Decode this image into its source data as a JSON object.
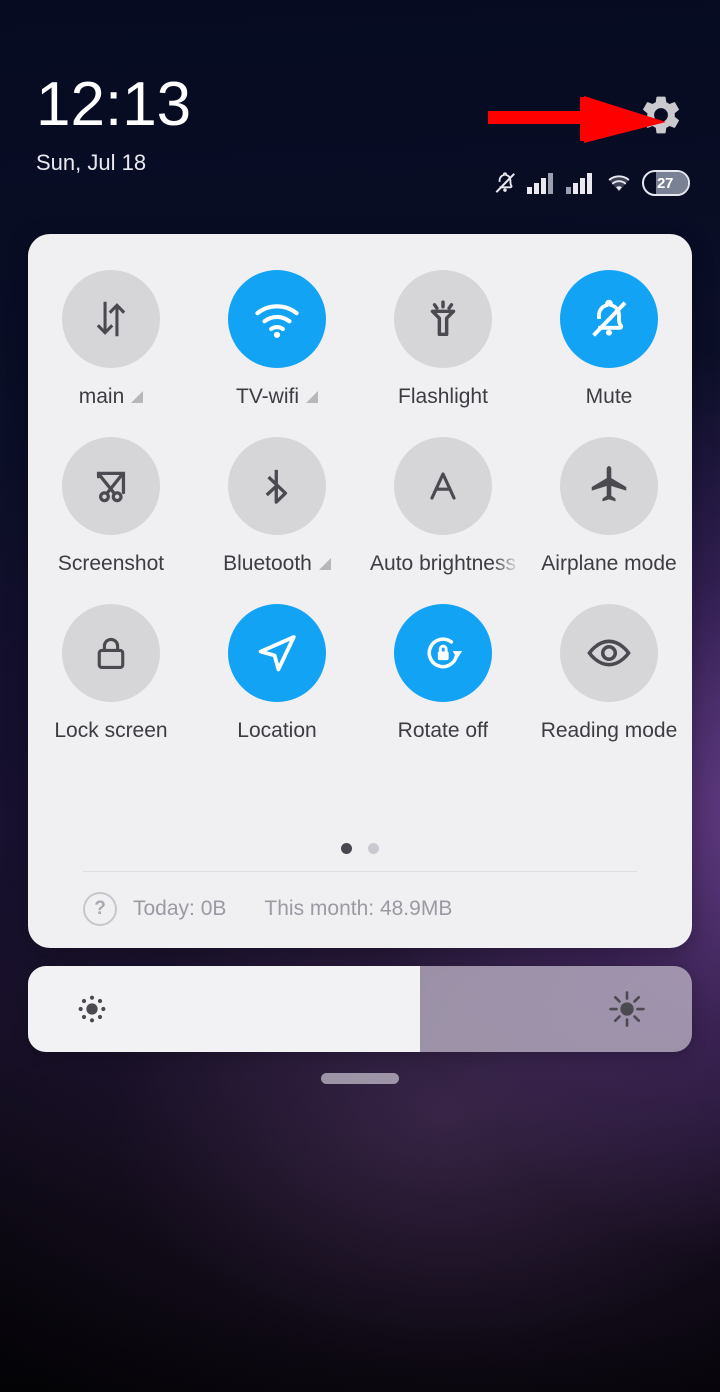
{
  "statusbar": {
    "clock": "12:13",
    "date": "Sun, Jul 18",
    "battery_percent": "27",
    "icons": [
      "mute-bell-icon",
      "signal-sim1-icon",
      "signal-sim2-icon",
      "wifi-icon",
      "battery-icon"
    ],
    "settings_icon": "gear-icon",
    "annotation": "red-arrow-pointing-at-gear"
  },
  "panel": {
    "tiles": [
      {
        "label": "main",
        "icon": "mobile-data-icon",
        "state": "off",
        "has_expander": true
      },
      {
        "label": "TV-wifi",
        "icon": "wifi-icon",
        "state": "on",
        "has_expander": true
      },
      {
        "label": "Flashlight",
        "icon": "flashlight-icon",
        "state": "off",
        "has_expander": false
      },
      {
        "label": "Mute",
        "icon": "bell-muted-icon",
        "state": "on",
        "has_expander": false
      },
      {
        "label": "Screenshot",
        "icon": "scissors-crop-icon",
        "state": "off",
        "has_expander": false
      },
      {
        "label": "Bluetooth",
        "icon": "bluetooth-icon",
        "state": "off",
        "has_expander": true
      },
      {
        "label": "Auto brightness",
        "icon": "auto-brightness-a-icon",
        "state": "off",
        "has_expander": false
      },
      {
        "label": "Airplane mode",
        "icon": "airplane-icon",
        "state": "off",
        "has_expander": false
      },
      {
        "label": "Lock screen",
        "icon": "padlock-icon",
        "state": "off",
        "has_expander": false
      },
      {
        "label": "Location",
        "icon": "navigation-arrow-icon",
        "state": "on",
        "has_expander": false
      },
      {
        "label": "Rotate off",
        "icon": "rotation-lock-icon",
        "state": "on",
        "has_expander": false
      },
      {
        "label": "Reading mode",
        "icon": "eye-icon",
        "state": "off",
        "has_expander": false
      }
    ],
    "pager": {
      "pages": 2,
      "active_index": 0
    },
    "usage": {
      "help_icon": "question-mark-icon",
      "today": "Today: 0B",
      "month": "This month: 48.9MB"
    }
  },
  "brightness": {
    "value_percent": 59,
    "low_icon": "brightness-low-icon",
    "high_icon": "brightness-high-icon"
  },
  "colors": {
    "accent_on": "#12a3f5",
    "tile_off": "#d6d6d9",
    "panel_bg": "#f0f0f3",
    "label": "#3c3c42",
    "muted_text": "#9a9aa2",
    "annotation_red": "#ff0000"
  },
  "drag_handle": "panel-drag-handle"
}
